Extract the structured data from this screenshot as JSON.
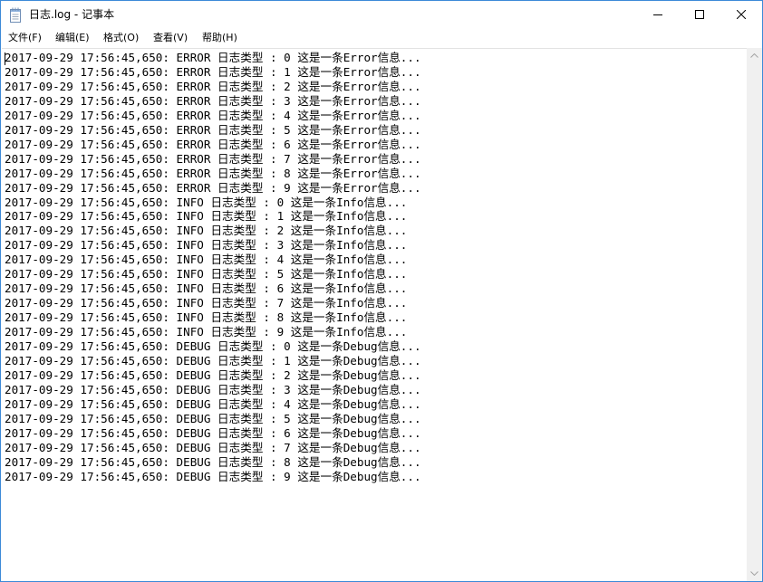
{
  "window": {
    "title": "日志.log - 记事本"
  },
  "titlebar_buttons": {
    "minimize": "minimize-icon",
    "maximize": "maximize-icon",
    "close": "close-icon"
  },
  "menu": {
    "items": [
      {
        "label": "文件(F)"
      },
      {
        "label": "编辑(E)"
      },
      {
        "label": "格式(O)"
      },
      {
        "label": "查看(V)"
      },
      {
        "label": "帮助(H)"
      }
    ]
  },
  "editor": {
    "content": "2017-09-29 17:56:45,650: ERROR 日志类型 : 0 这是一条Error信息...\n2017-09-29 17:56:45,650: ERROR 日志类型 : 1 这是一条Error信息...\n2017-09-29 17:56:45,650: ERROR 日志类型 : 2 这是一条Error信息...\n2017-09-29 17:56:45,650: ERROR 日志类型 : 3 这是一条Error信息...\n2017-09-29 17:56:45,650: ERROR 日志类型 : 4 这是一条Error信息...\n2017-09-29 17:56:45,650: ERROR 日志类型 : 5 这是一条Error信息...\n2017-09-29 17:56:45,650: ERROR 日志类型 : 6 这是一条Error信息...\n2017-09-29 17:56:45,650: ERROR 日志类型 : 7 这是一条Error信息...\n2017-09-29 17:56:45,650: ERROR 日志类型 : 8 这是一条Error信息...\n2017-09-29 17:56:45,650: ERROR 日志类型 : 9 这是一条Error信息...\n2017-09-29 17:56:45,650: INFO 日志类型 : 0 这是一条Info信息...\n2017-09-29 17:56:45,650: INFO 日志类型 : 1 这是一条Info信息...\n2017-09-29 17:56:45,650: INFO 日志类型 : 2 这是一条Info信息...\n2017-09-29 17:56:45,650: INFO 日志类型 : 3 这是一条Info信息...\n2017-09-29 17:56:45,650: INFO 日志类型 : 4 这是一条Info信息...\n2017-09-29 17:56:45,650: INFO 日志类型 : 5 这是一条Info信息...\n2017-09-29 17:56:45,650: INFO 日志类型 : 6 这是一条Info信息...\n2017-09-29 17:56:45,650: INFO 日志类型 : 7 这是一条Info信息...\n2017-09-29 17:56:45,650: INFO 日志类型 : 8 这是一条Info信息...\n2017-09-29 17:56:45,650: INFO 日志类型 : 9 这是一条Info信息...\n2017-09-29 17:56:45,650: DEBUG 日志类型 : 0 这是一条Debug信息...\n2017-09-29 17:56:45,650: DEBUG 日志类型 : 1 这是一条Debug信息...\n2017-09-29 17:56:45,650: DEBUG 日志类型 : 2 这是一条Debug信息...\n2017-09-29 17:56:45,650: DEBUG 日志类型 : 3 这是一条Debug信息...\n2017-09-29 17:56:45,650: DEBUG 日志类型 : 4 这是一条Debug信息...\n2017-09-29 17:56:45,650: DEBUG 日志类型 : 5 这是一条Debug信息...\n2017-09-29 17:56:45,650: DEBUG 日志类型 : 6 这是一条Debug信息...\n2017-09-29 17:56:45,650: DEBUG 日志类型 : 7 这是一条Debug信息...\n2017-09-29 17:56:45,650: DEBUG 日志类型 : 8 这是一条Debug信息...\n2017-09-29 17:56:45,650: DEBUG 日志类型 : 9 这是一条Debug信息..."
  },
  "scrollbar": {
    "up": "scroll-up-arrow-icon",
    "down": "scroll-down-arrow-icon"
  },
  "colors": {
    "window_border": "#3c8ad8",
    "scrollbar_track": "#f0f0f0"
  }
}
